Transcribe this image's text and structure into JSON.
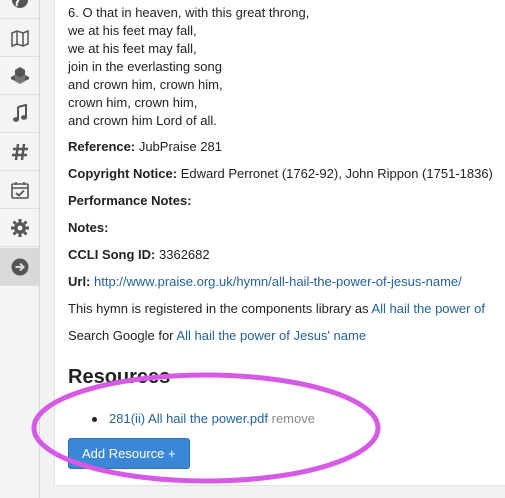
{
  "sidebar": {
    "items": [
      {
        "icon": "globe-icon"
      },
      {
        "icon": "map-icon"
      },
      {
        "icon": "cubes-icon"
      },
      {
        "icon": "music-icon"
      },
      {
        "icon": "hashtag-icon"
      },
      {
        "icon": "calendar-check-icon"
      },
      {
        "icon": "gear-icon"
      },
      {
        "icon": "arrow-right-circle-icon",
        "active": true
      }
    ]
  },
  "verse": "6. O that in heaven, with this great throng,\nwe at his feet may fall,\nwe at his feet may fall,\njoin in the everlasting song\nand crown him, crown him,\ncrown him, crown him,\nand crown him Lord of all.",
  "fields": {
    "reference_label": "Reference:",
    "reference_value": "JubPraise 281",
    "copyright_label": "Copyright Notice:",
    "copyright_value": "Edward Perronet (1762-92), John Rippon (1751-1836)",
    "performance_label": "Performance Notes:",
    "notes_label": "Notes:",
    "ccli_label": "CCLI Song ID:",
    "ccli_value": "3362682",
    "url_label": "Url:",
    "url_value": "http://www.praise.org.uk/hymn/all-hail-the-power-of-jesus-name/",
    "registered_text": "This hymn is registered in the components library as",
    "registered_link": "All hail the power of",
    "search_text": "Search Google for",
    "search_link": "All hail the power of Jesus' name"
  },
  "resources": {
    "title": "Resources",
    "items": [
      {
        "label": "281(ii) All hail the power.pdf",
        "remove": "remove"
      }
    ],
    "add_button": "Add Resource +"
  },
  "colors": {
    "link": "#23629b",
    "button": "#3a87d6",
    "annotation": "#d65ae6"
  }
}
